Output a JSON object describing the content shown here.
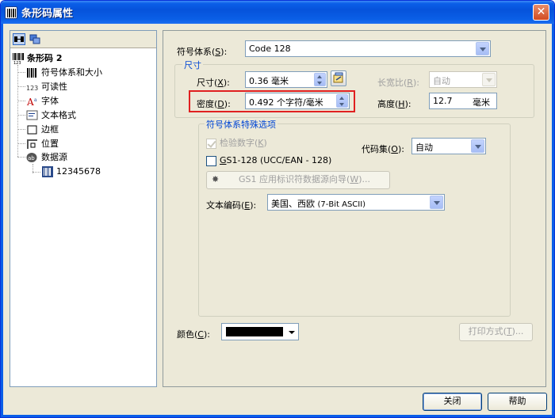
{
  "window": {
    "title": "条形码属性",
    "close_glyph": "✕"
  },
  "tree": {
    "root_label": "条形码 2",
    "items": [
      {
        "label": "符号体系和大小",
        "icon": "barcode-icon"
      },
      {
        "label": "可读性",
        "icon": "readability-123-icon"
      },
      {
        "label": "字体",
        "icon": "font-icon"
      },
      {
        "label": "文本格式",
        "icon": "text-format-icon"
      },
      {
        "label": "边框",
        "icon": "border-icon"
      },
      {
        "label": "位置",
        "icon": "position-icon"
      },
      {
        "label": "数据源",
        "icon": "data-source-icon"
      }
    ],
    "data_item": {
      "label": "12345678",
      "icon": "data-value-icon"
    }
  },
  "symbology": {
    "label": "符号体系(",
    "hotkey": "S",
    "label_end": "):",
    "value": "Code 128"
  },
  "size_group": {
    "title": "尺寸",
    "size_label": "尺寸(",
    "size_hotkey": "X",
    "size_label_end": "):",
    "size_value": "0.36 毫米",
    "ratio_label": "长宽比(",
    "ratio_hotkey": "R",
    "ratio_label_end": "):",
    "ratio_value": "自动",
    "density_label": "密度(",
    "density_hotkey": "D",
    "density_label_end": "):",
    "density_value": "0.492 个字符/毫米",
    "height_label": "高度(",
    "height_hotkey": "H",
    "height_label_end": "):",
    "height_value": "12.7",
    "height_unit": "毫米"
  },
  "special_group": {
    "title": "符号体系特殊选项",
    "check_digit_label": "检验数字(",
    "check_digit_hotkey": "K",
    "check_digit_end": ")",
    "check_digit_checked": true,
    "codeset_label": "代码集(",
    "codeset_hotkey": "O",
    "codeset_end": "):",
    "codeset_value": "自动",
    "gs1_hotkey": "G",
    "gs1_label": "S1-128 (UCC/EAN - 128)",
    "gs1_checked": false,
    "wizard_label": "GS1 应用标识符数据源向导(",
    "wizard_hotkey": "W",
    "wizard_end": ")...",
    "encoding_label": "文本编码(",
    "encoding_hotkey": "E",
    "encoding_end": "):",
    "encoding_value_main": "美国、西欧",
    "encoding_value_detail": "(7-Bit ASCII)"
  },
  "color": {
    "label": "颜色(",
    "hotkey": "C",
    "label_end": "):",
    "swatch": "#000000"
  },
  "print_method": {
    "label": "打印方式(",
    "hotkey": "T",
    "label_end": ")..."
  },
  "footer": {
    "close_label": "关闭",
    "help_label": "帮助"
  },
  "colors": {
    "accent": "#0046d5",
    "highlight": "#e02020",
    "titlebar": "#0a5ee8"
  }
}
